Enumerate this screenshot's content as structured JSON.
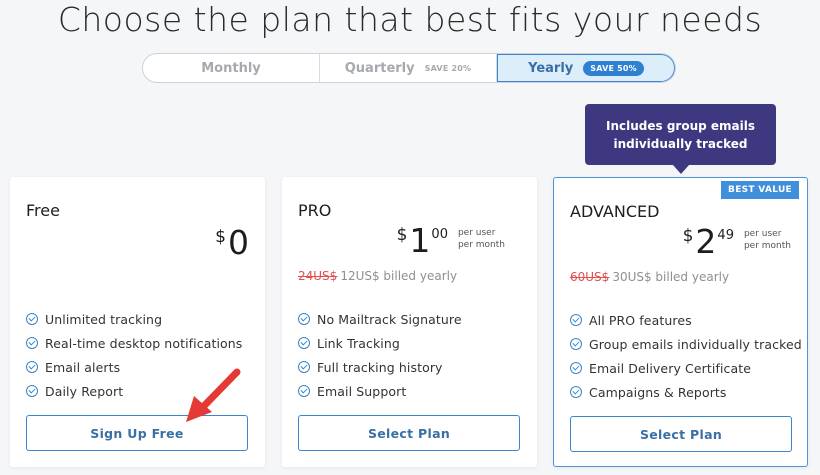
{
  "headline": "Choose the plan that best fits your needs",
  "billing_toggle": {
    "options": [
      {
        "label": "Monthly",
        "save": ""
      },
      {
        "label": "Quarterly",
        "save": "SAVE 20%"
      },
      {
        "label": "Yearly",
        "save": "SAVE 50%"
      }
    ],
    "selected": "Yearly"
  },
  "tooltip": "Includes group emails individually tracked",
  "plans": [
    {
      "name": "Free",
      "currency": "$",
      "price_whole": "0",
      "price_cents": "",
      "per_line1": "",
      "per_line2": "",
      "billed_strike": "",
      "billed_text": "",
      "features": [
        "Unlimited tracking",
        "Real-time desktop notifications",
        "Email alerts",
        "Daily Report"
      ],
      "button": "Sign Up Free"
    },
    {
      "name": "PRO",
      "currency": "$",
      "price_whole": "1",
      "price_cents": "00",
      "per_line1": "per user",
      "per_line2": "per month",
      "billed_strike": "24US$",
      "billed_text": "12US$ billed yearly",
      "features": [
        "No Mailtrack Signature",
        "Link Tracking",
        "Full tracking history",
        "Email Support"
      ],
      "button": "Select Plan"
    },
    {
      "name": "ADVANCED",
      "badge": "BEST VALUE",
      "currency": "$",
      "price_whole": "2",
      "price_cents": "49",
      "per_line1": "per user",
      "per_line2": "per month",
      "billed_strike": "60US$",
      "billed_text": "30US$ billed yearly",
      "features": [
        "All PRO features",
        "Group emails individually tracked",
        "Email Delivery Certificate",
        "Campaigns & Reports"
      ],
      "button": "Select Plan"
    }
  ],
  "colors": {
    "accent": "#3a86c8",
    "tooltip_bg": "#3d3880",
    "annotation_arrow": "#e53935",
    "strike": "#e05050"
  }
}
